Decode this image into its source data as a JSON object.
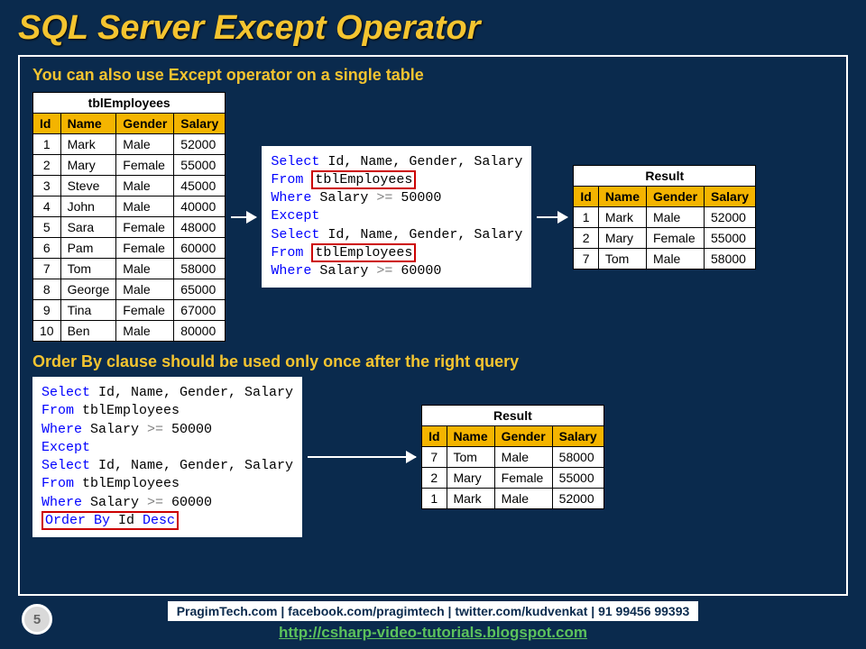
{
  "title": "SQL Server Except Operator",
  "subheading1": "You can also use Except operator on a single table",
  "subheading2": "Order By clause should be used only once after the right query",
  "employees_table": {
    "title": "tblEmployees",
    "headers": [
      "Id",
      "Name",
      "Gender",
      "Salary"
    ],
    "rows": [
      [
        "1",
        "Mark",
        "Male",
        "52000"
      ],
      [
        "2",
        "Mary",
        "Female",
        "55000"
      ],
      [
        "3",
        "Steve",
        "Male",
        "45000"
      ],
      [
        "4",
        "John",
        "Male",
        "40000"
      ],
      [
        "5",
        "Sara",
        "Female",
        "48000"
      ],
      [
        "6",
        "Pam",
        "Female",
        "60000"
      ],
      [
        "7",
        "Tom",
        "Male",
        "58000"
      ],
      [
        "8",
        "George",
        "Male",
        "65000"
      ],
      [
        "9",
        "Tina",
        "Female",
        "67000"
      ],
      [
        "10",
        "Ben",
        "Male",
        "80000"
      ]
    ]
  },
  "sql1": {
    "select": "Select",
    "cols": " Id, Name, Gender, Salary",
    "from": "From",
    "tbl": "tblEmployees",
    "where": "Where",
    "cond1": " Salary >= 50000",
    "except": "Except",
    "cond2": " Salary >= 60000",
    "gte": ">="
  },
  "result1": {
    "title": "Result",
    "headers": [
      "Id",
      "Name",
      "Gender",
      "Salary"
    ],
    "rows": [
      [
        "1",
        "Mark",
        "Male",
        "52000"
      ],
      [
        "2",
        "Mary",
        "Female",
        "55000"
      ],
      [
        "7",
        "Tom",
        "Male",
        "58000"
      ]
    ]
  },
  "sql2": {
    "select": "Select",
    "cols": " Id, Name, Gender, Salary",
    "from": "From",
    "tbl": " tblEmployees",
    "where": "Where",
    "cond1": " Salary >= 50000",
    "except": "Except",
    "cond2": " Salary >= 60000",
    "orderby": "Order By",
    "ordercol": " Id ",
    "desc": "Desc",
    "gte": ">="
  },
  "result2": {
    "title": "Result",
    "headers": [
      "Id",
      "Name",
      "Gender",
      "Salary"
    ],
    "rows": [
      [
        "7",
        "Tom",
        "Male",
        "58000"
      ],
      [
        "2",
        "Mary",
        "Female",
        "55000"
      ],
      [
        "1",
        "Mark",
        "Male",
        "52000"
      ]
    ]
  },
  "footer": {
    "text": "PragimTech.com | facebook.com/pragimtech | twitter.com/kudvenkat | 91 99456 99393",
    "link": "http://csharp-video-tutorials.blogspot.com"
  },
  "page_number": "5"
}
